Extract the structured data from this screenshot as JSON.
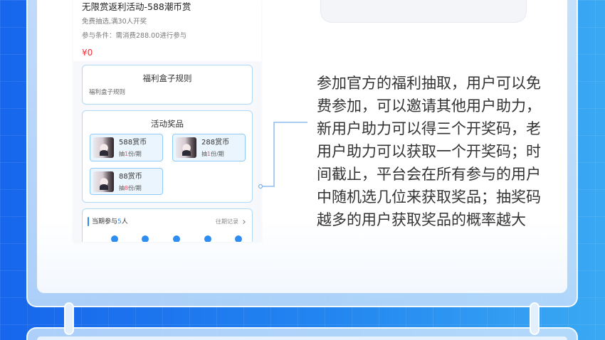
{
  "colors": {
    "accent": "#2f8cf0",
    "price": "#f0313a",
    "highlight": "#f0506a",
    "card_border": "#b3d9f7",
    "text": "#333333"
  },
  "phone": {
    "header": {
      "title": "无限赏返利活动-588潮币赏",
      "subtitle": "免费抽选,满30人开奖",
      "condition": "参与条件：需消费288.00进行参与",
      "price": "¥0"
    },
    "rules": {
      "title": "福利盒子规则",
      "content": "福利盒子规则"
    },
    "prizes": {
      "title": "活动奖品",
      "items": [
        {
          "name": "588赏币",
          "qty_prefix": "抽",
          "qty": "1",
          "qty_suffix": "份/期",
          "icon": "prize-avatar-icon"
        },
        {
          "name": "288赏币",
          "qty_prefix": "抽",
          "qty": "1",
          "qty_suffix": "份/期",
          "icon": "prize-avatar-icon"
        },
        {
          "name": "88赏币",
          "qty_prefix": "抽",
          "qty": "8",
          "qty_suffix": "份/期",
          "icon": "prize-avatar-icon"
        }
      ]
    },
    "participants": {
      "label_prefix": "当期参与",
      "count": "5",
      "label_suffix": "人",
      "history_link": "往期记录",
      "history_icon": "chevron-right-icon"
    }
  },
  "description": {
    "lines": [
      "参加官方的福利抽取，用户可以免",
      "费参加，可以邀请其他用户助力，",
      "新用户助力可以得三个开奖码，老",
      "用户助力可以获取一个开奖码；时",
      "间截止，平台会在所有参与的用户",
      "中随机选几位来获取奖品；抽奖码",
      "越多的用户获取奖品的概率越大"
    ]
  }
}
